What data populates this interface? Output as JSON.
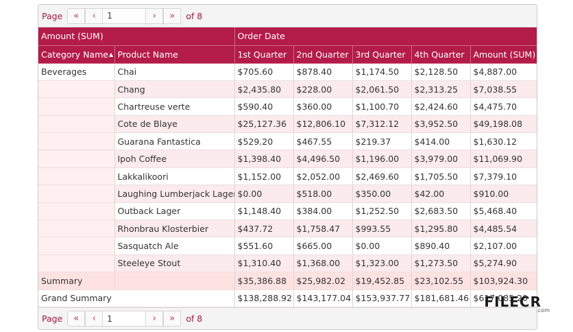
{
  "pager": {
    "page_label": "Page",
    "current_page": "1",
    "of_label": "of 8",
    "first_icon": "«",
    "prev_icon": "‹",
    "next_icon": "›",
    "last_icon": "»"
  },
  "header": {
    "data_field": "Amount (SUM)",
    "column_field": "Order Date",
    "category_col": "Category Name",
    "product_col": "Product Name",
    "q1": "1st Quarter",
    "q2": "2nd Quarter",
    "q3": "3rd Quarter",
    "q4": "4th Quarter",
    "total": "Amount (SUM)"
  },
  "category": "Beverages",
  "rows": [
    {
      "product": "Chai",
      "q1": "$705.60",
      "q2": "$878.40",
      "q3": "$1,174.50",
      "q4": "$2,128.50",
      "total": "$4,887.00"
    },
    {
      "product": "Chang",
      "q1": "$2,435.80",
      "q2": "$228.00",
      "q3": "$2,061.50",
      "q4": "$2,313.25",
      "total": "$7,038.55"
    },
    {
      "product": "Chartreuse verte",
      "q1": "$590.40",
      "q2": "$360.00",
      "q3": "$1,100.70",
      "q4": "$2,424.60",
      "total": "$4,475.70"
    },
    {
      "product": "Cote de Blaye",
      "q1": "$25,127.36",
      "q2": "$12,806.10",
      "q3": "$7,312.12",
      "q4": "$3,952.50",
      "total": "$49,198.08"
    },
    {
      "product": "Guarana Fantastica",
      "q1": "$529.20",
      "q2": "$467.55",
      "q3": "$219.37",
      "q4": "$414.00",
      "total": "$1,630.12"
    },
    {
      "product": "Ipoh Coffee",
      "q1": "$1,398.40",
      "q2": "$4,496.50",
      "q3": "$1,196.00",
      "q4": "$3,979.00",
      "total": "$11,069.90"
    },
    {
      "product": "Lakkalikoori",
      "q1": "$1,152.00",
      "q2": "$2,052.00",
      "q3": "$2,469.60",
      "q4": "$1,705.50",
      "total": "$7,379.10"
    },
    {
      "product": "Laughing Lumberjack Lager",
      "q1": "$0.00",
      "q2": "$518.00",
      "q3": "$350.00",
      "q4": "$42.00",
      "total": "$910.00"
    },
    {
      "product": "Outback Lager",
      "q1": "$1,148.40",
      "q2": "$384.00",
      "q3": "$1,252.50",
      "q4": "$2,683.50",
      "total": "$5,468.40"
    },
    {
      "product": "Rhonbrau Klosterbier",
      "q1": "$437.72",
      "q2": "$1,758.47",
      "q3": "$993.55",
      "q4": "$1,295.80",
      "total": "$4,485.54"
    },
    {
      "product": "Sasquatch Ale",
      "q1": "$551.60",
      "q2": "$665.00",
      "q3": "$0.00",
      "q4": "$890.40",
      "total": "$2,107.00"
    },
    {
      "product": "Steeleye Stout",
      "q1": "$1,310.40",
      "q2": "$1,368.00",
      "q3": "$1,323.00",
      "q4": "$1,273.50",
      "total": "$5,274.90"
    }
  ],
  "summary": {
    "label": "Summary",
    "q1": "$35,386.88",
    "q2": "$25,982.02",
    "q3": "$19,452.85",
    "q4": "$23,102.55",
    "total": "$103,924.30"
  },
  "grand": {
    "label": "Grand Summary",
    "q1": "$138,288.92",
    "q2": "$143,177.04",
    "q3": "$153,937.77",
    "q4": "$181,681.46",
    "total": "$617,085.20"
  },
  "watermark": {
    "brand": "FILECR",
    "domain": ".com"
  },
  "colors": {
    "header_bg": "#b31b48",
    "alt_row": "#fbeaee",
    "summary_row": "#fde2e2",
    "pager_text": "#9b1c3c"
  }
}
